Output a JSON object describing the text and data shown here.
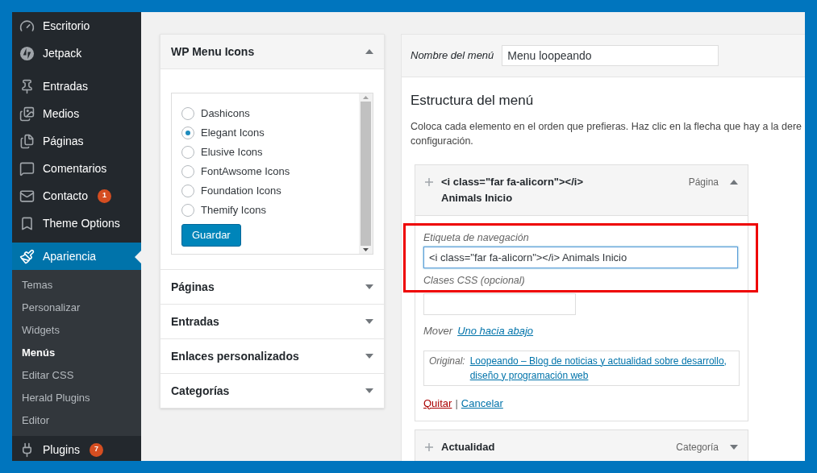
{
  "sidebar": {
    "groups": [
      {
        "items": [
          {
            "label": "Escritorio",
            "selected": false
          },
          {
            "label": "Jetpack",
            "selected": false
          }
        ]
      },
      {
        "items": [
          {
            "label": "Entradas",
            "selected": false
          },
          {
            "label": "Medios",
            "selected": false
          },
          {
            "label": "Páginas",
            "selected": false
          },
          {
            "label": "Comentarios",
            "selected": false
          },
          {
            "label": "Contacto",
            "selected": false,
            "badge": "1"
          },
          {
            "label": "Theme Options",
            "selected": false
          }
        ]
      },
      {
        "items": [
          {
            "label": "Apariencia",
            "selected": true,
            "children": [
              {
                "label": "Temas",
                "selected": false
              },
              {
                "label": "Personalizar",
                "selected": false
              },
              {
                "label": "Widgets",
                "selected": false
              },
              {
                "label": "Menús",
                "selected": true
              },
              {
                "label": "Editar CSS",
                "selected": false
              },
              {
                "label": "Herald Plugins",
                "selected": false
              },
              {
                "label": "Editor",
                "selected": false
              }
            ]
          },
          {
            "label": "Plugins",
            "selected": false,
            "badge": "7"
          }
        ]
      }
    ]
  },
  "menu_icons_panel": {
    "title": "WP Menu Icons",
    "expanded": true,
    "options": [
      {
        "label": "Dashicons",
        "selected": false
      },
      {
        "label": "Elegant Icons",
        "selected": true
      },
      {
        "label": "Elusive Icons",
        "selected": false
      },
      {
        "label": "FontAwsome Icons",
        "selected": false
      },
      {
        "label": "Foundation Icons",
        "selected": false
      },
      {
        "label": "Themify Icons",
        "selected": false
      }
    ],
    "button": "Guardar"
  },
  "accordions": [
    {
      "title": "Páginas",
      "expanded": false
    },
    {
      "title": "Entradas",
      "expanded": false
    },
    {
      "title": "Enlaces personalizados",
      "expanded": false
    },
    {
      "title": "Categorías",
      "expanded": false
    }
  ],
  "menu_name": {
    "label": "Nombre del menú",
    "value": "Menu loopeando"
  },
  "structure": {
    "heading": "Estructura del menú",
    "description_lines": [
      "Coloca cada elemento en el orden que prefieras. Haz clic en la flecha que hay a la dere",
      "configuración."
    ]
  },
  "menu_items": [
    {
      "title_lines": [
        "<i class=\"far fa-alicorn\"></i>",
        "Animals Inicio"
      ],
      "type": "Página",
      "expanded": true,
      "highlighted": true,
      "nav_label": {
        "label": "Etiqueta de navegación",
        "value": "<i class=\"far fa-alicorn\"></i> Animals Inicio"
      },
      "css_classes": {
        "label": "Clases CSS (opcional)"
      },
      "move": {
        "label": "Mover",
        "link": "Uno hacia abajo"
      },
      "original": {
        "label": "Original:",
        "link": "Loopeando – Blog de noticias y actualidad sobre desarrollo, diseño y programación web"
      },
      "actions": {
        "remove": "Quitar",
        "separator": "|",
        "cancel": "Cancelar"
      }
    },
    {
      "title_lines": [
        "Actualidad"
      ],
      "type": "Categoría",
      "expanded": false
    }
  ]
}
